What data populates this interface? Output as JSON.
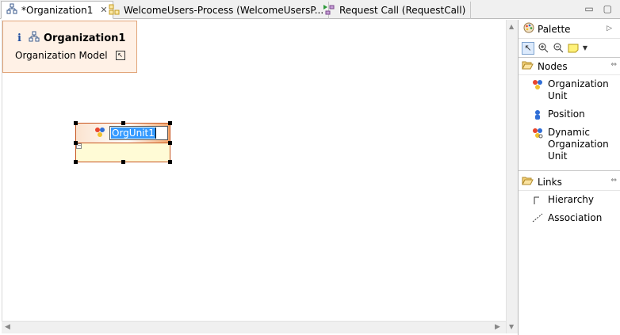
{
  "tabs": [
    {
      "label": "*Organization1",
      "icon": "org-model-icon",
      "active": true,
      "closable": true
    },
    {
      "label": "WelcomeUsers-Process (WelcomeUsersP...",
      "icon": "process-icon",
      "active": false
    },
    {
      "label": "Request Call (RequestCall)",
      "icon": "process-flow-icon",
      "active": false
    }
  ],
  "info_popup": {
    "title": "Organization1",
    "subtitle": "Organization Model"
  },
  "org_unit": {
    "name_value": "OrgUnit1"
  },
  "palette": {
    "title": "Palette",
    "drawers": [
      {
        "label": "Nodes",
        "entries": [
          {
            "label": "Organization Unit",
            "icon": "org-unit-icon"
          },
          {
            "label": "Position",
            "icon": "position-icon"
          },
          {
            "label": "Dynamic Organization Unit",
            "icon": "dynamic-org-unit-icon"
          }
        ]
      },
      {
        "label": "Links",
        "entries": [
          {
            "label": "Hierarchy",
            "icon": "hierarchy-link-icon"
          },
          {
            "label": "Association",
            "icon": "association-link-icon"
          }
        ]
      }
    ]
  },
  "colors": {
    "selection": "#3399ff",
    "org_unit_border": "#c7541d",
    "popup_bg": "#fff1e6"
  }
}
